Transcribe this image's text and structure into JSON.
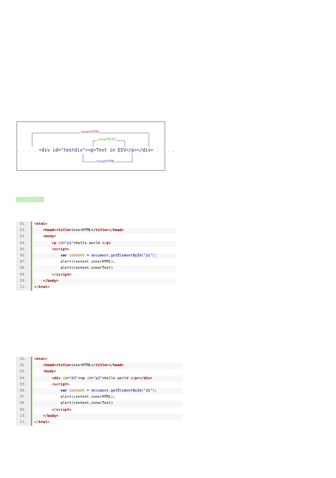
{
  "diagram": {
    "outer_label": "outerHTML",
    "inner_text_label": "innerTEXT",
    "inner_html_label": "innerHTML",
    "code_line": "<div id=\"testdiv\"><p>Text in DIV</p></div>",
    "dots_left": ". . . .",
    "dots_right": ". . . ."
  },
  "block1": {
    "lines": [
      {
        "num": "01.",
        "html": "<span class='tag'>&lt;html&gt;</span>"
      },
      {
        "num": "02.",
        "html": "    <span class='tag'>&lt;head&gt;&lt;title&gt;</span><span class='plain'>innerHTML</span><span class='tag'>&lt;/title&gt;&lt;/head&gt;</span>"
      },
      {
        "num": "03.",
        "html": "    <span class='tag'>&lt;body&gt;</span>"
      },
      {
        "num": "04.",
        "html": "        <span class='tag'>&lt;p</span> <span class='var'>id</span>=<span class='str'>\"p1\"</span><span class='tag'>&gt;</span><span class='plain'>hello world </span><span class='tag'>&lt;/p&gt;</span>"
      },
      {
        "num": "05.",
        "html": "        <span class='tag'>&lt;script&gt;</span>"
      },
      {
        "num": "06.",
        "html": "            <span class='kw'>var</span> <span class='var'>content</span> = <span class='str'>document</span>.getElementById(<span class='str'>\"p1\"</span>);"
      },
      {
        "num": "07.",
        "html": "            <span class='plain'>alert(content.innerHTML);</span>"
      },
      {
        "num": "08.",
        "html": "            <span class='plain'>alert(content.innerText)</span>"
      },
      {
        "num": "09.",
        "html": "        <span class='tag'>&lt;/script&gt;</span>"
      },
      {
        "num": "10.",
        "html": "    <span class='tag'>&lt;/body&gt;</span>"
      },
      {
        "num": "11.",
        "html": "<span class='tag'>&lt;/html&gt;</span>"
      }
    ]
  },
  "block2": {
    "lines": [
      {
        "num": "01.",
        "html": "<span class='tag'>&lt;html&gt;</span>"
      },
      {
        "num": "02.",
        "html": "    <span class='tag'>&lt;head&gt;&lt;title&gt;</span><span class='plain'>innerHTML</span><span class='tag'>&lt;/title&gt;&lt;/head&gt;</span>"
      },
      {
        "num": "03.",
        "html": "    <span class='tag'>&lt;body&gt;</span>"
      },
      {
        "num": "04.",
        "html": "        <span class='tag'>&lt;div</span> <span class='var'>id</span>=<span class='str'>\"d1\"</span><span class='tag'>&gt;&lt;p</span> <span class='var'>id</span>=<span class='str'>\"p1\"</span><span class='tag'>&gt;</span><span class='plain'>hello world </span><span class='tag'>&lt;/p&gt;&lt;/div&gt;</span>"
      },
      {
        "num": "05.",
        "html": "        <span class='tag'>&lt;script&gt;</span>"
      },
      {
        "num": "06.",
        "html": "            <span class='kw'>var</span> <span class='var'>content</span> = <span class='str'>document</span>.getElementById(<span class='str'>\"d1\"</span>);"
      },
      {
        "num": "07.",
        "html": "            <span class='plain'>alert(content.innerHTML);</span>"
      },
      {
        "num": "08.",
        "html": "            <span class='plain'>alert(content.innerText)</span>"
      },
      {
        "num": "09.",
        "html": "        <span class='tag'>&lt;/script&gt;</span>"
      },
      {
        "num": "10.",
        "html": "    <span class='tag'>&lt;/body&gt;</span>"
      },
      {
        "num": "11.",
        "html": "<span class='tag'>&lt;/html&gt;</span>"
      }
    ]
  }
}
